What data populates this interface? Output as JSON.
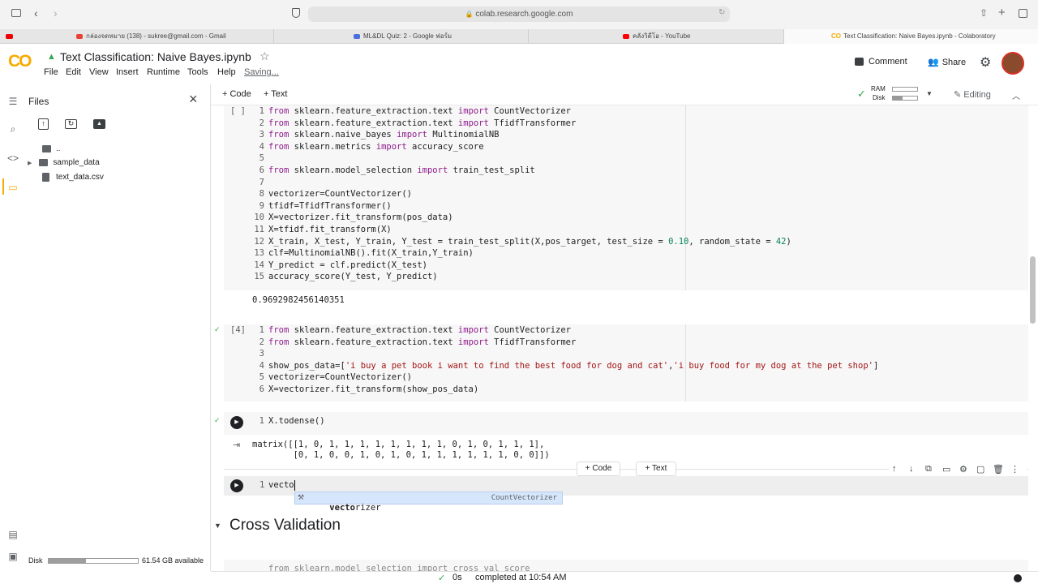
{
  "browser": {
    "url": "colab.research.google.com",
    "tabs": [
      {
        "label": "กล่องจดหมาย (138) - sukree@gmail.com - Gmail",
        "color": "#ea4335"
      },
      {
        "label": "ML&DL Quiz: 2 - Google ฟอร์ม",
        "color": "#4c6fe0"
      },
      {
        "label": "คลังวิดีโอ - YouTube",
        "color": "#ff0000"
      },
      {
        "label": "Text Classification: Naive Bayes.ipynb - Colaboratory",
        "color": "#f9ab00"
      }
    ]
  },
  "colab": {
    "logo": "CO",
    "title": "Text Classification: Naive Bayes.ipynb",
    "menu": [
      "File",
      "Edit",
      "View",
      "Insert",
      "Runtime",
      "Tools",
      "Help"
    ],
    "saving": "Saving...",
    "comment": "Comment",
    "share": "Share"
  },
  "sidebar": {
    "title": "Files",
    "items": [
      {
        "name": "..",
        "type": "up"
      },
      {
        "name": "sample_data",
        "type": "folder"
      },
      {
        "name": "text_data.csv",
        "type": "file"
      }
    ],
    "disk_label": "Disk",
    "disk_available": "61.54 GB available",
    "disk_fraction": 0.42
  },
  "toolbar": {
    "code": "Code",
    "text": "Text",
    "ram": "RAM",
    "disk": "Disk",
    "editing": "Editing"
  },
  "cells": {
    "cell1": {
      "prompt": "[ ]",
      "lines": [
        "from sklearn.feature_extraction.text import CountVectorizer",
        "from sklearn.feature_extraction.text import TfidfTransformer",
        "from sklearn.naive_bayes import MultinomialNB",
        "from sklearn.metrics import accuracy_score",
        "",
        "from sklearn.model_selection import train_test_split",
        "",
        "vectorizer=CountVectorizer()",
        "tfidf=TfidfTransformer()",
        "X=vectorizer.fit_transform(pos_data)",
        "X=tfidf.fit_transform(X)",
        "X_train, X_test, Y_train, Y_test = train_test_split(X,pos_target, test_size = 0.10, random_state = 42)",
        "clf=MultinomialNB().fit(X_train,Y_train)",
        "Y_predict = clf.predict(X_test)",
        "accuracy_score(Y_test, Y_predict)"
      ],
      "output": "0.9692982456140351"
    },
    "cell2": {
      "prompt": "[4]",
      "lines": [
        "from sklearn.feature_extraction.text import CountVectorizer",
        "from sklearn.feature_extraction.text import TfidfTransformer",
        "",
        "show_pos_data=['i buy a pet book i want to find the best food for dog and cat','i buy food for my dog at the pet shop']",
        "vectorizer=CountVectorizer()",
        "X=vectorizer.fit_transform(show_pos_data)"
      ]
    },
    "cell3": {
      "lines": [
        "X.todense()"
      ],
      "output_lines": [
        "matrix([[1, 0, 1, 1, 1, 1, 1, 1, 1, 1, 0, 1, 0, 1, 1, 1],",
        "        [0, 1, 0, 0, 1, 0, 1, 0, 1, 1, 1, 1, 1, 1, 0, 0]])"
      ]
    },
    "cell4": {
      "line_number": "1",
      "text": "vecto",
      "autocomplete_match": "vecto",
      "autocomplete_rest": "rizer",
      "autocomplete_type": "CountVectorizer"
    },
    "add_code": "+ Code",
    "add_text": "+ Text"
  },
  "section": {
    "title": "Cross Validation",
    "next_line": "from sklearn.model_selection import cross_val_score"
  },
  "status": {
    "time": "0s",
    "message": "completed at 10:54 AM"
  }
}
